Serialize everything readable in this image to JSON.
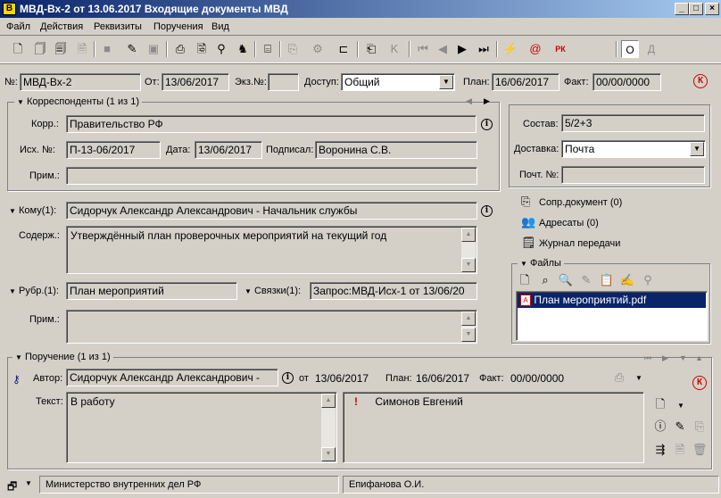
{
  "window": {
    "title": "МВД-Вх-2 от 13.06.2017 Входящие документы МВД",
    "app_icon": "В"
  },
  "menu": [
    "Файл",
    "Действия",
    "Реквизиты",
    "Поручения",
    "Вид"
  ],
  "toolbar": {
    "o_label": "О",
    "d_label": "Д",
    "rk_label": "РК"
  },
  "doc": {
    "no_label": "№:",
    "no_value": "МВД-Вх-2",
    "from_label": "От:",
    "from_value": "13/06/2017",
    "copy_label": "Экз.№:",
    "copy_value": "",
    "access_label": "Доступ:",
    "access_value": "Общий",
    "plan_label": "План:",
    "plan_value": "16/06/2017",
    "fact_label": "Факт:",
    "fact_value": "00/00/0000",
    "k_label": "К"
  },
  "correspondents": {
    "title": "Корреспонденты (1 из 1)",
    "korr_label": "Корр.:",
    "korr_value": "Правительство РФ",
    "out_label": "Исх. №:",
    "out_value": "П-13-06/2017",
    "date_label": "Дата:",
    "date_value": "13/06/2017",
    "signed_label": "Подписал:",
    "signed_value": "Воронина С.В.",
    "note_label": "Прим.:",
    "note_value": ""
  },
  "right_panel": {
    "sostav_label": "Состав:",
    "sostav_value": "5/2+3",
    "delivery_label": "Доставка:",
    "delivery_value": "Почта",
    "postno_label": "Почт. №:",
    "postno_value": "",
    "links": [
      "Сопр.документ (0)",
      "Адресаты (0)",
      "Журнал передачи"
    ]
  },
  "main": {
    "to_label": "Кому(1):",
    "to_value": "Сидорчук Александр Александрович - Начальник службы",
    "content_label": "Содерж.:",
    "content_value": "Утверждённый план проверочных мероприятий на текущий год",
    "rubric_label": "Рубр.(1):",
    "rubric_value": "План мероприятий",
    "links_label": "Связки(1):",
    "links_value": "Запрос:МВД-Исх-1 от 13/06/20",
    "note_label": "Прим.:",
    "note_value": ""
  },
  "files": {
    "title": "Файлы",
    "items": [
      "План мероприятий.pdf"
    ]
  },
  "assignment": {
    "title": "Поручение (1 из 1)",
    "author_label": "Автор:",
    "author_value": "Сидорчук Александр Александрович -",
    "from_label": "от",
    "from_value": "13/06/2017",
    "plan_label": "План:",
    "plan_value": "16/06/2017",
    "fact_label": "Факт:",
    "fact_value": "00/00/0000",
    "text_label": "Текст:",
    "text_value": "В работу",
    "executor": "Симонов Евгений",
    "executor_mark": "!",
    "k_label": "К"
  },
  "status": {
    "org": "Министерство внутренних дел РФ",
    "user": "Епифанова О.И."
  }
}
